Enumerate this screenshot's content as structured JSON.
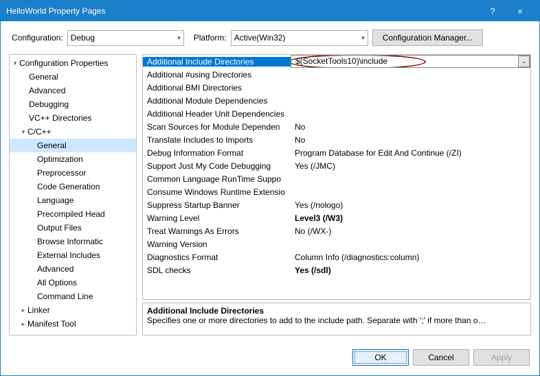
{
  "titlebar": {
    "title": "HelloWorld Property Pages",
    "help": "?",
    "close": "×"
  },
  "configRow": {
    "configLabel": "Configuration:",
    "configValue": "Debug",
    "platformLabel": "Platform:",
    "platformValue": "Active(Win32)",
    "configMgr": "Configuration Manager..."
  },
  "tree": {
    "items": [
      {
        "label": "Configuration Properties",
        "level": "l0",
        "exp": "▾",
        "selected": false
      },
      {
        "label": "General",
        "level": "l1"
      },
      {
        "label": "Advanced",
        "level": "l1"
      },
      {
        "label": "Debugging",
        "level": "l1"
      },
      {
        "label": "VC++ Directories",
        "level": "l1"
      },
      {
        "label": "C/C++",
        "level": "l1e",
        "exp": "▾"
      },
      {
        "label": "General",
        "level": "l2",
        "selected": true
      },
      {
        "label": "Optimization",
        "level": "l2"
      },
      {
        "label": "Preprocessor",
        "level": "l2"
      },
      {
        "label": "Code Generation",
        "level": "l2"
      },
      {
        "label": "Language",
        "level": "l2"
      },
      {
        "label": "Precompiled Head",
        "level": "l2"
      },
      {
        "label": "Output Files",
        "level": "l2"
      },
      {
        "label": "Browse Informatic",
        "level": "l2"
      },
      {
        "label": "External Includes",
        "level": "l2"
      },
      {
        "label": "Advanced",
        "level": "l2"
      },
      {
        "label": "All Options",
        "level": "l2"
      },
      {
        "label": "Command Line",
        "level": "l2"
      },
      {
        "label": "Linker",
        "level": "l1e",
        "exp": "▸"
      },
      {
        "label": "Manifest Tool",
        "level": "l1e",
        "exp": "▸"
      }
    ]
  },
  "props": {
    "rows": [
      {
        "name": "Additional Include Directories",
        "value": "$(SocketTools10)\\include",
        "selected": true,
        "highlight": true
      },
      {
        "name": "Additional #using Directories",
        "value": ""
      },
      {
        "name": "Additional BMI Directories",
        "value": ""
      },
      {
        "name": "Additional Module Dependencies",
        "value": ""
      },
      {
        "name": "Additional Header Unit Dependencies",
        "value": ""
      },
      {
        "name": "Scan Sources for Module Dependen",
        "value": "No"
      },
      {
        "name": "Translate Includes to Imports",
        "value": "No"
      },
      {
        "name": "Debug Information Format",
        "value": "Program Database for Edit And Continue (/ZI)"
      },
      {
        "name": "Support Just My Code Debugging",
        "value": "Yes (/JMC)"
      },
      {
        "name": "Common Language RunTime Suppo",
        "value": ""
      },
      {
        "name": "Consume Windows Runtime Extensio",
        "value": ""
      },
      {
        "name": "Suppress Startup Banner",
        "value": "Yes (/nologo)"
      },
      {
        "name": "Warning Level",
        "value": "Level3 (/W3)",
        "bold": true
      },
      {
        "name": "Treat Warnings As Errors",
        "value": "No (/WX-)"
      },
      {
        "name": "Warning Version",
        "value": ""
      },
      {
        "name": "Diagnostics Format",
        "value": "Column Info (/diagnostics:column)"
      },
      {
        "name": "SDL checks",
        "value": "Yes (/sdl)",
        "bold": true
      }
    ],
    "desc": {
      "title": "Additional Include Directories",
      "text": "Specifies one or more directories to add to the include path. Separate with ';' if more than o…"
    }
  },
  "buttons": {
    "ok": "OK",
    "cancel": "Cancel",
    "apply": "Apply"
  }
}
